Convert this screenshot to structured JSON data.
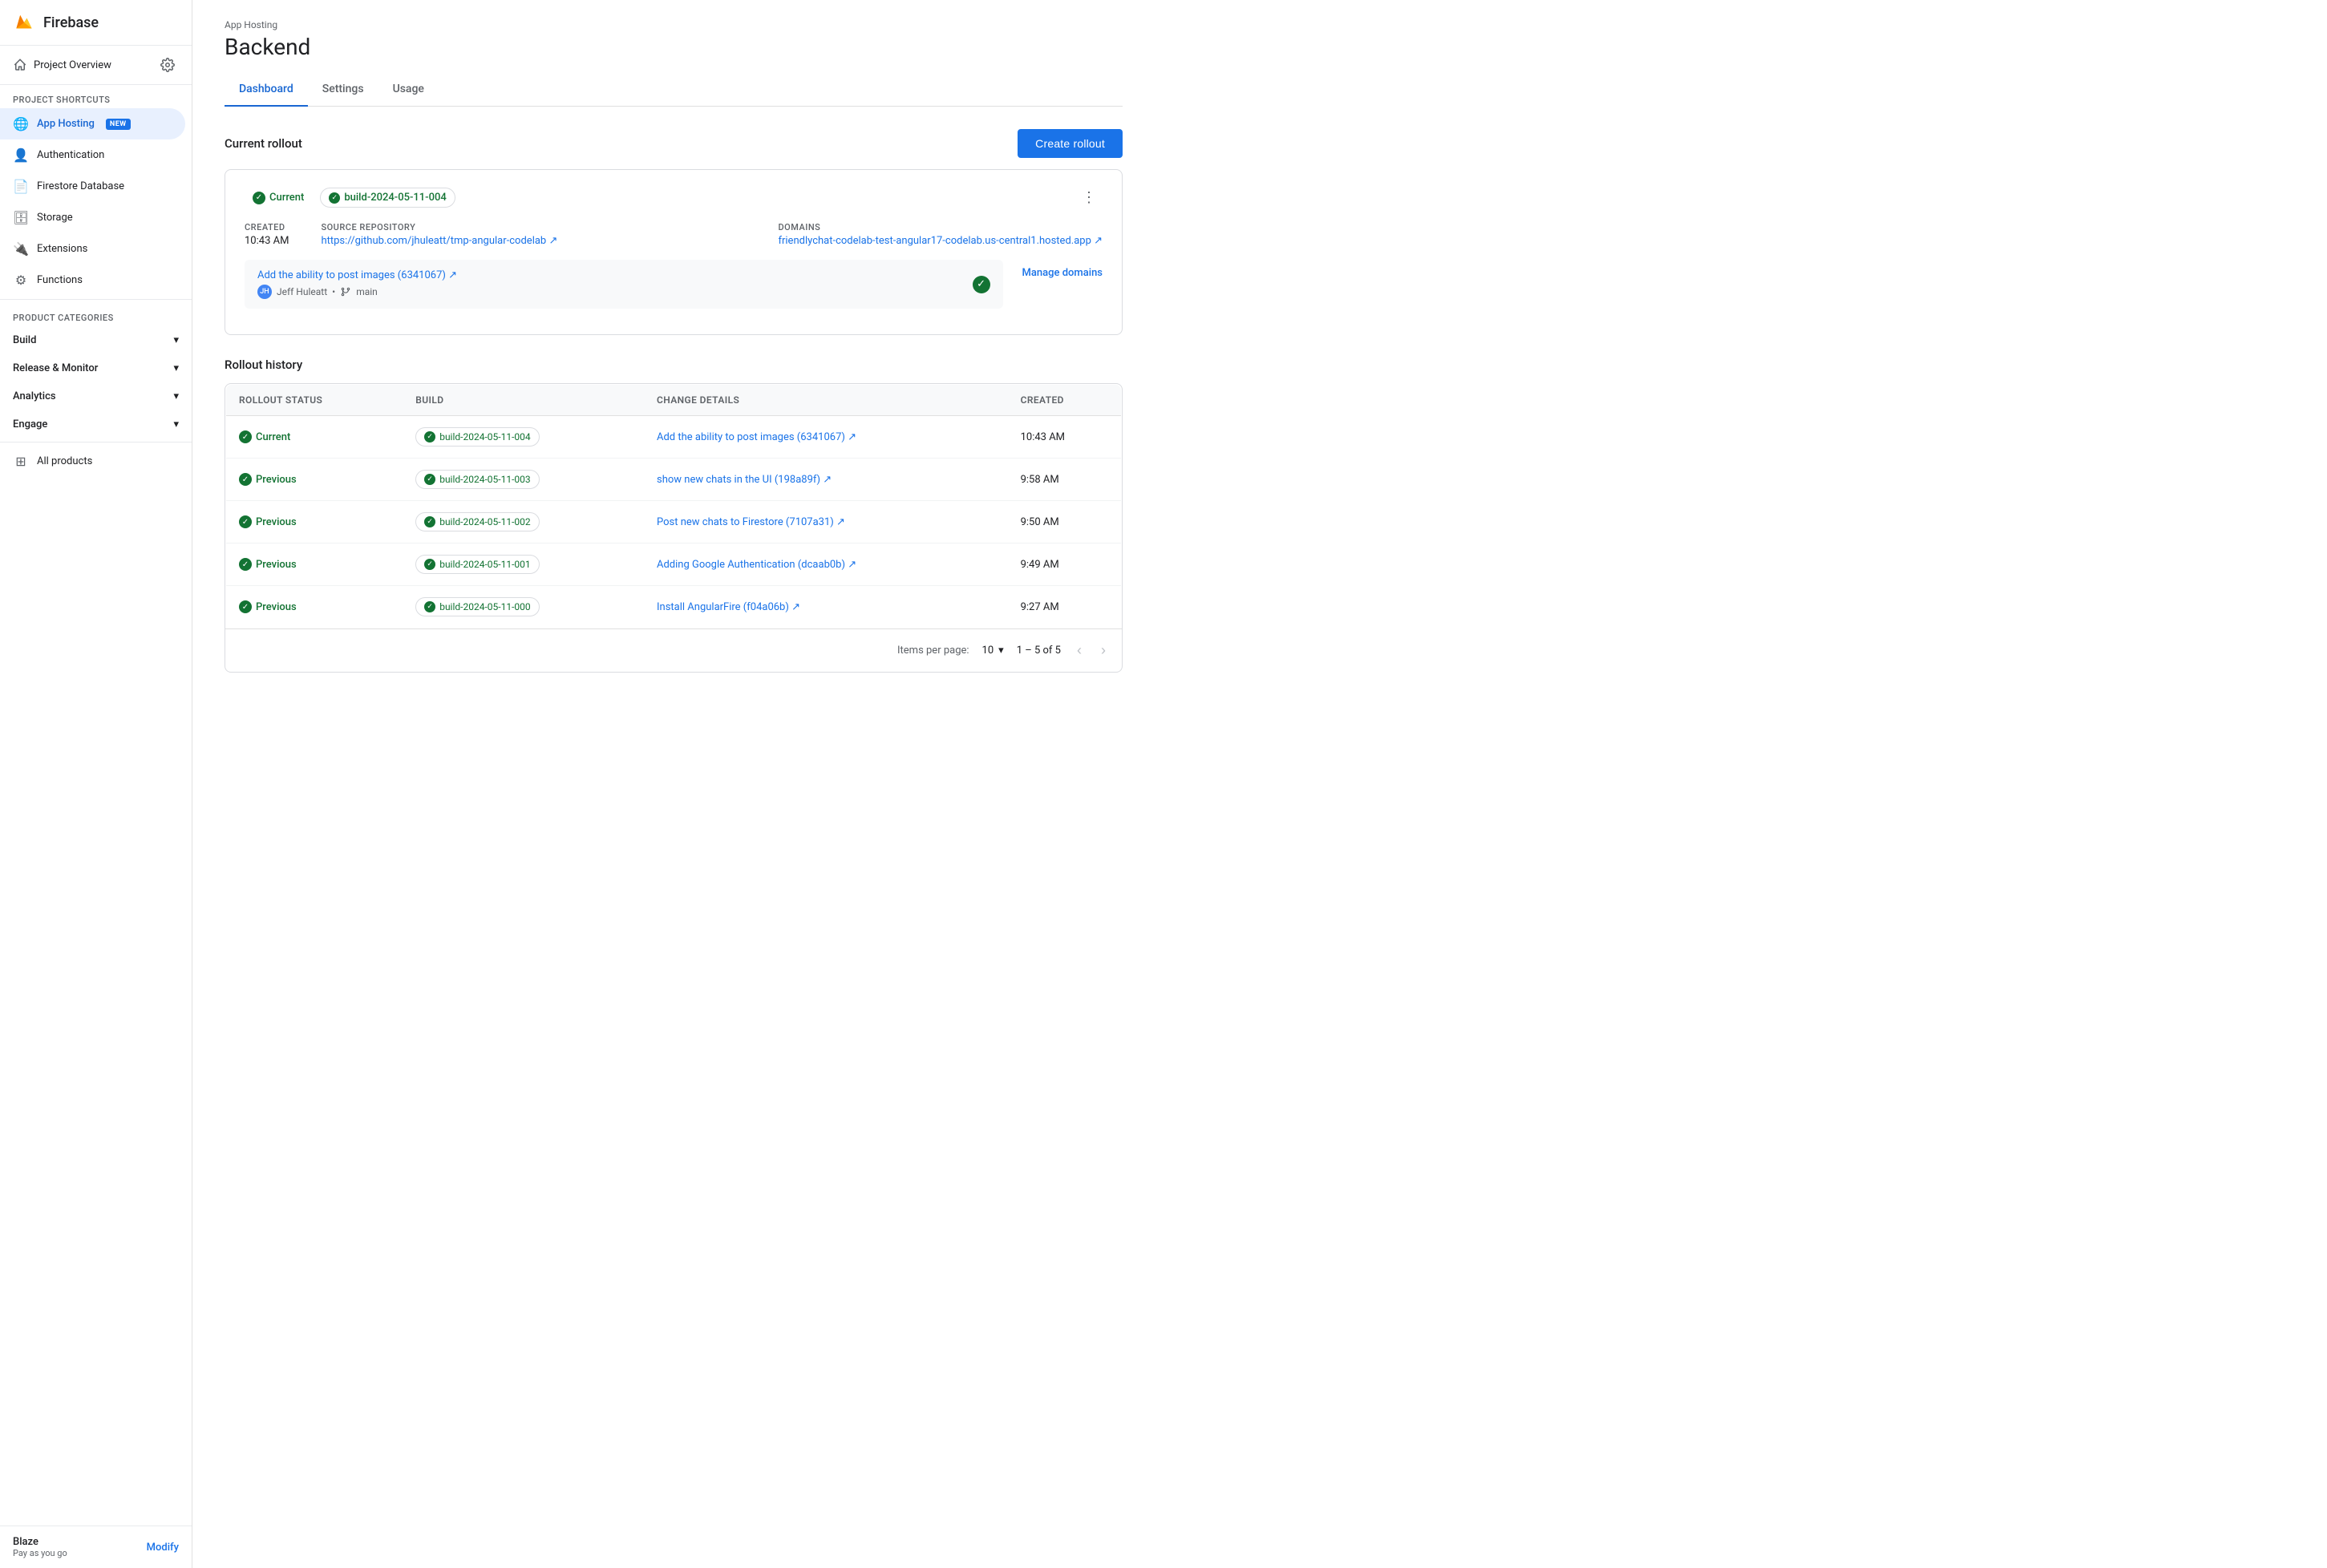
{
  "sidebar": {
    "app_name": "Firebase",
    "project_overview": "Project Overview",
    "shortcuts_label": "Project shortcuts",
    "nav_items": [
      {
        "id": "app-hosting",
        "label": "App Hosting",
        "badge": "NEW",
        "active": true,
        "icon": "🌐"
      },
      {
        "id": "authentication",
        "label": "Authentication",
        "icon": "👤"
      },
      {
        "id": "firestore",
        "label": "Firestore Database",
        "icon": "📄"
      },
      {
        "id": "storage",
        "label": "Storage",
        "icon": "🗄"
      },
      {
        "id": "extensions",
        "label": "Extensions",
        "icon": "🔌"
      },
      {
        "id": "functions",
        "label": "Functions",
        "icon": "⚙"
      }
    ],
    "categories": [
      {
        "id": "build",
        "label": "Build"
      },
      {
        "id": "release-monitor",
        "label": "Release & Monitor"
      },
      {
        "id": "analytics",
        "label": "Analytics"
      },
      {
        "id": "engage",
        "label": "Engage"
      }
    ],
    "all_products": "All products",
    "footer": {
      "plan": "Blaze",
      "subtitle": "Pay as you go",
      "modify_label": "Modify"
    }
  },
  "header": {
    "breadcrumb": "App Hosting",
    "title": "Backend"
  },
  "tabs": [
    {
      "id": "dashboard",
      "label": "Dashboard",
      "active": true
    },
    {
      "id": "settings",
      "label": "Settings",
      "active": false
    },
    {
      "id": "usage",
      "label": "Usage",
      "active": false
    }
  ],
  "create_rollout_button": "Create rollout",
  "current_rollout": {
    "section_title": "Current rollout",
    "status": "Current",
    "build_tag": "build-2024-05-11-004",
    "created_label": "Created",
    "created_value": "10:43 AM",
    "source_repo_label": "Source repository",
    "source_repo_url": "https://github.com/jhuleatt/tmp-angular-codelab",
    "source_repo_display": "https://github.com/jhuleatt/tmp-angular-codelab ↗",
    "domains_label": "Domains",
    "domains_url": "friendlychat-codelab-test-angular17-codelab.us-central1.hosted.app",
    "domains_display": "friendlychat-codelab-test-angular17-codelab.us-central1.hosted.app ↗",
    "commit_text": "Add the ability to post images (6341067) ↗",
    "commit_author": "Jeff Huleatt",
    "commit_branch": "main",
    "manage_domains": "Manage domains"
  },
  "rollout_history": {
    "section_title": "Rollout history",
    "columns": [
      "Rollout Status",
      "Build",
      "Change details",
      "Created"
    ],
    "rows": [
      {
        "status": "Current",
        "build": "build-2024-05-11-004",
        "change": "Add the ability to post images (6341067) ↗",
        "created": "10:43 AM"
      },
      {
        "status": "Previous",
        "build": "build-2024-05-11-003",
        "change": "show new chats in the UI (198a89f) ↗",
        "created": "9:58 AM"
      },
      {
        "status": "Previous",
        "build": "build-2024-05-11-002",
        "change": "Post new chats to Firestore (7107a31) ↗",
        "created": "9:50 AM"
      },
      {
        "status": "Previous",
        "build": "build-2024-05-11-001",
        "change": "Adding Google Authentication (dcaab0b) ↗",
        "created": "9:49 AM"
      },
      {
        "status": "Previous",
        "build": "build-2024-05-11-000",
        "change": "Install AngularFire (f04a06b) ↗",
        "created": "9:27 AM"
      }
    ],
    "pagination": {
      "items_per_page_label": "Items per page:",
      "items_per_page_value": "10",
      "range": "1 – 5 of 5"
    }
  }
}
